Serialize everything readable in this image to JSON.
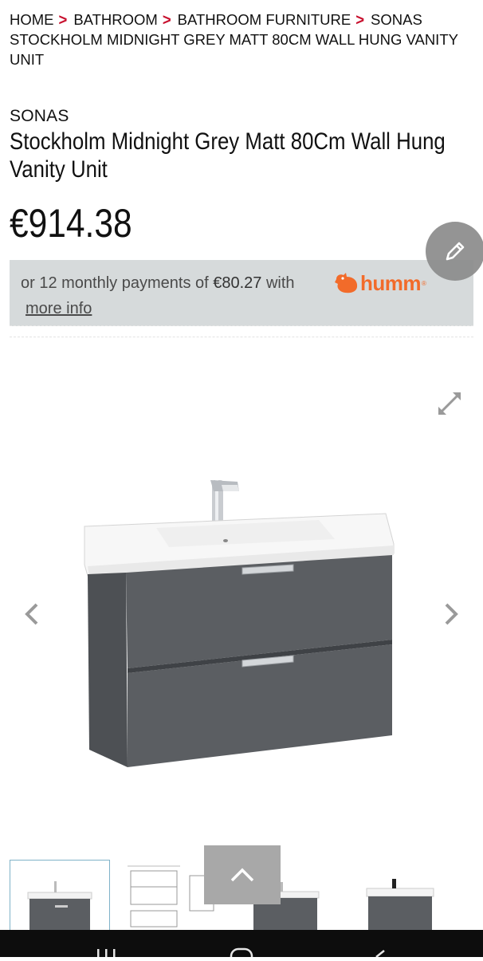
{
  "breadcrumb": [
    {
      "label": "HOME"
    },
    {
      "label": "BATHROOM"
    },
    {
      "label": "BATHROOM FURNITURE"
    },
    {
      "label": "SONAS STOCKHOLM MIDNIGHT GREY MATT 80CM WALL HUNG VANITY UNIT"
    }
  ],
  "product": {
    "brand": "SONAS",
    "title": "Stockholm Midnight Grey Matt 80Cm Wall Hung Vanity Unit",
    "price": "€914.38"
  },
  "finance": {
    "text_prefix": "or 12 monthly payments of ",
    "amount": "€80.27",
    "text_suffix": " with",
    "provider_logo_text": "humm",
    "more_info_label": "more info"
  },
  "gallery": {
    "image_count": 4,
    "active_index": 0
  },
  "icons": {
    "edit": "pencil-icon",
    "expand": "expand-icon",
    "prev": "chevron-left-icon",
    "next": "chevron-right-icon",
    "scroll_top": "chevron-up-icon"
  },
  "colors": {
    "breadcrumb_separator": "#c8102e",
    "finance_bg": "#d6dadb",
    "humm_orange": "#f26b2a",
    "vanity_grey": "#5b5e62"
  }
}
